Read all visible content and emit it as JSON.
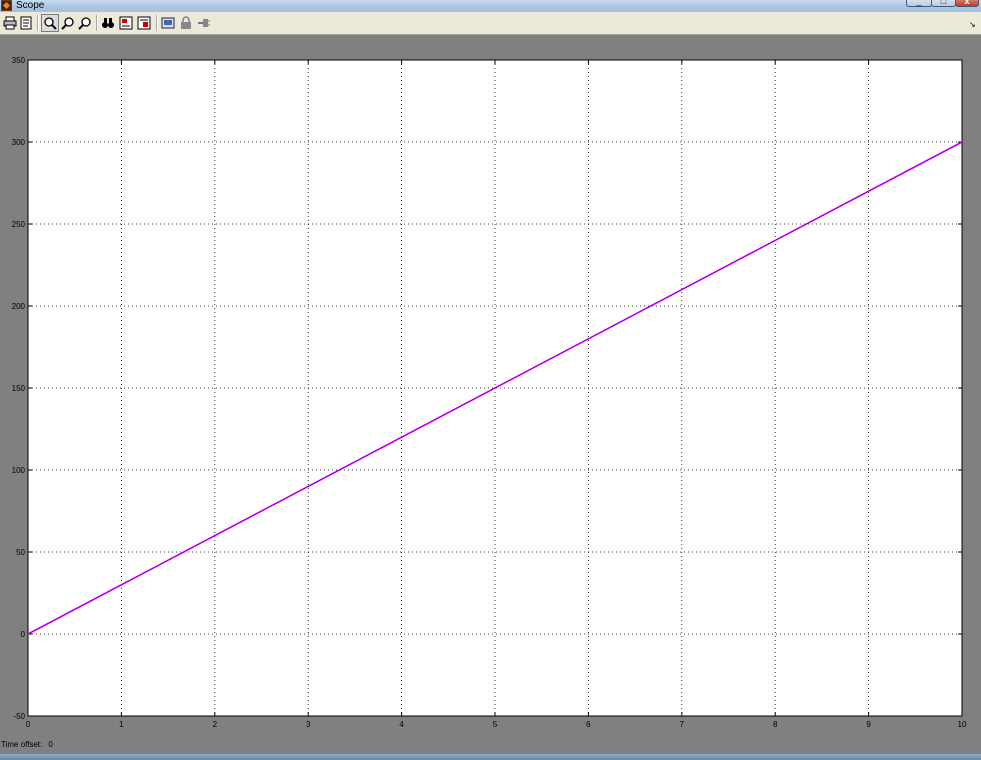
{
  "window": {
    "title": "Scope"
  },
  "toolbar": {
    "buttons": [
      {
        "name": "print-icon"
      },
      {
        "name": "parameters-icon"
      },
      {
        "name": "zoom-icon"
      },
      {
        "name": "zoom-x-icon"
      },
      {
        "name": "zoom-y-icon"
      },
      {
        "name": "autoscale-icon"
      },
      {
        "name": "save-axes-settings-icon"
      },
      {
        "name": "restore-axes-settings-icon"
      },
      {
        "name": "floating-scope-icon"
      },
      {
        "name": "lock-axes-icon"
      },
      {
        "name": "signal-selection-icon"
      }
    ]
  },
  "status": {
    "time_offset_label": "Time offset:",
    "time_offset_value": "0"
  },
  "colors": {
    "plot_line": "#ff00ff",
    "plot_line_overlay": "#0000cc",
    "axes_bg": "#ffffff",
    "figure_bg": "#808080"
  },
  "chart_data": {
    "type": "line",
    "x": [
      0,
      10
    ],
    "series": [
      {
        "values": [
          0,
          300
        ]
      }
    ],
    "xlim": [
      0,
      10
    ],
    "ylim": [
      -50,
      350
    ],
    "xticks": [
      "0",
      "1",
      "2",
      "3",
      "4",
      "5",
      "6",
      "7",
      "8",
      "9",
      "10"
    ],
    "yticks": [
      "-50",
      "0",
      "50",
      "100",
      "150",
      "200",
      "250",
      "300",
      "350"
    ],
    "grid": true
  }
}
